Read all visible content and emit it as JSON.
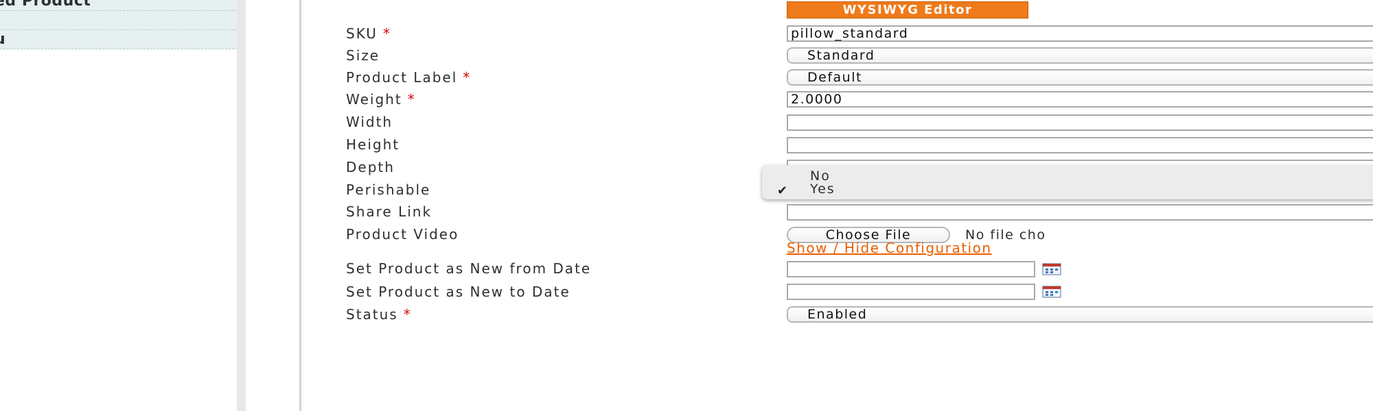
{
  "sidebar": {
    "items": [
      {
        "label": "ed Product"
      },
      {
        "label": ""
      },
      {
        "label": "u"
      }
    ]
  },
  "editor_button": {
    "label": "WYSIWYG Editor"
  },
  "form": {
    "sku": {
      "label": "SKU",
      "required_mark": "*",
      "value": "pillow_standard"
    },
    "size": {
      "label": "Size",
      "value": "Standard"
    },
    "product_label": {
      "label": "Product Label",
      "required_mark": "*",
      "value": "Default"
    },
    "weight": {
      "label": "Weight",
      "required_mark": "*",
      "value": "2.0000"
    },
    "width": {
      "label": "Width",
      "value": ""
    },
    "height": {
      "label": "Height",
      "value": ""
    },
    "depth": {
      "label": "Depth",
      "value": ""
    },
    "perishable": {
      "label": "Perishable",
      "options": [
        "No",
        "Yes"
      ],
      "selected": "Yes"
    },
    "share_link": {
      "label": "Share Link",
      "value": ""
    },
    "product_video": {
      "label": "Product Video",
      "button": "Choose File",
      "status": "No file cho"
    },
    "config_link": "Show / Hide Configuration",
    "new_from_date": {
      "label": "Set Product as New from Date",
      "value": ""
    },
    "new_to_date": {
      "label": "Set Product as New to Date",
      "value": ""
    },
    "status": {
      "label": "Status",
      "required_mark": "*",
      "value": "Enabled"
    }
  },
  "icons": {
    "checkmark": "checkmark-icon",
    "calendar": "calendar-icon"
  },
  "colors": {
    "accent": "#ef7a1a",
    "link": "#eb5e00",
    "required": "#d40707",
    "sidebar_highlight": "#e6f0f1"
  }
}
